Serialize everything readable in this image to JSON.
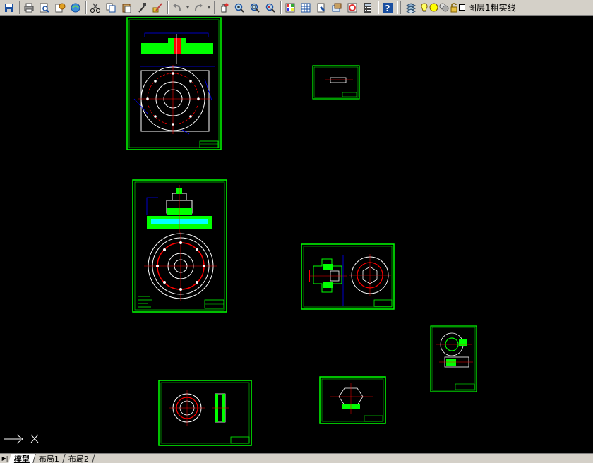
{
  "toolbar": {
    "layer_name": "图层1粗实线",
    "icons": [
      "save-icon",
      "print-icon",
      "print-preview-icon",
      "publish-icon",
      "etransmit-icon",
      "cut-icon",
      "copy-icon",
      "paste-icon",
      "match-properties-icon",
      "block-editor-icon",
      "undo-icon",
      "redo-icon",
      "pan-icon",
      "zoom-realtime-icon",
      "zoom-window-icon",
      "zoom-previous-icon",
      "properties-icon",
      "design-center-icon",
      "tool-palette-icon",
      "sheet-set-icon",
      "markup-icon",
      "calculator-icon",
      "help-icon",
      "layer-manager-icon"
    ]
  },
  "tabs": [
    {
      "label": "模型",
      "active": true
    },
    {
      "label": "布局1",
      "active": false
    },
    {
      "label": "布局2",
      "active": false
    }
  ],
  "colors": {
    "canvas": "#000000",
    "border": "#00ff00",
    "section": "#00ff00",
    "center": "#ff0000",
    "dims": "#0000ff",
    "outline": "#ffffff",
    "hatch": "#00ffff",
    "note": "#ffff00",
    "toolbar": "#d4d0c8"
  }
}
